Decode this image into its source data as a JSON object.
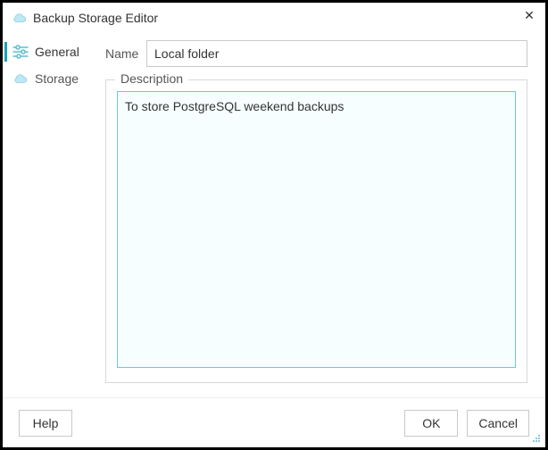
{
  "window": {
    "title": "Backup Storage Editor"
  },
  "sidebar": {
    "tabs": [
      {
        "id": "general",
        "label": "General",
        "icon": "settings",
        "active": true
      },
      {
        "id": "storage",
        "label": "Storage",
        "icon": "cloud",
        "active": false
      }
    ]
  },
  "form": {
    "name_label": "Name",
    "name_value": "Local folder",
    "description_label": "Description",
    "description_value": "To store PostgreSQL weekend backups"
  },
  "buttons": {
    "help": "Help",
    "ok": "OK",
    "cancel": "Cancel"
  }
}
